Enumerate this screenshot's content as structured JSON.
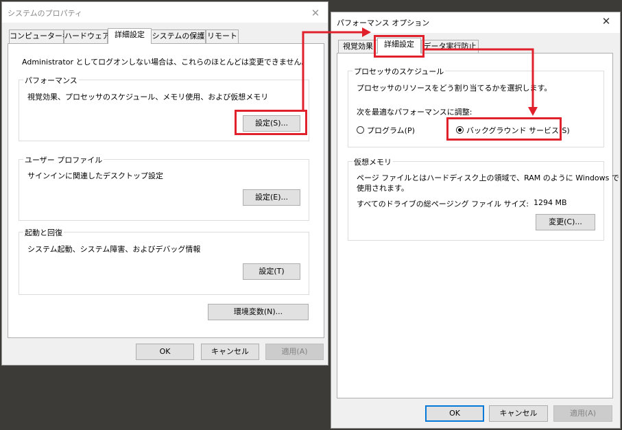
{
  "colors": {
    "accent": "#0078d7",
    "highlight": "#e0202a",
    "desktop": "#3c3b37"
  },
  "sys": {
    "title": "システムのプロパティ",
    "close": "✕",
    "tabs": [
      "コンピューター名",
      "ハードウェア",
      "詳細設定",
      "システムの保護",
      "リモート"
    ],
    "intro": "Administrator としてログオンしない場合は、これらのほとんどは変更できません。",
    "perf": {
      "label": "パフォーマンス",
      "desc": "視覚効果、プロセッサのスケジュール、メモリ使用、および仮想メモリ",
      "button": "設定(S)..."
    },
    "profile": {
      "label": "ユーザー プロファイル",
      "desc": "サインインに関連したデスクトップ設定",
      "button": "設定(E)..."
    },
    "startup": {
      "label": "起動と回復",
      "desc": "システム起動、システム障害、およびデバッグ情報",
      "button": "設定(T)"
    },
    "env_button": "環境変数(N)...",
    "ok": "OK",
    "cancel": "キャンセル",
    "apply": "適用(A)"
  },
  "perfopt": {
    "title": "パフォーマンス オプション",
    "close": "✕",
    "tabs": [
      "視覚効果",
      "詳細設定",
      "データ実行防止"
    ],
    "sched": {
      "label": "プロセッサのスケジュール",
      "desc": "プロセッサのリソースをどう割り当てるかを選択します。",
      "adjust": "次を最適なパフォーマンスに調整:",
      "opt_program": "プログラム(P)",
      "opt_background": "バックグラウンド サービス(S)",
      "selected": "background"
    },
    "vm": {
      "label": "仮想メモリ",
      "desc1": "ページ ファイルとはハードディスク上の領域で、RAM のように Windows で",
      "desc2": "使用されます。",
      "total_label": "すべてのドライブの総ページング ファイル サイズ:",
      "total_value": "1294 MB",
      "button": "変更(C)..."
    },
    "ok": "OK",
    "cancel": "キャンセル",
    "apply": "適用(A)"
  }
}
